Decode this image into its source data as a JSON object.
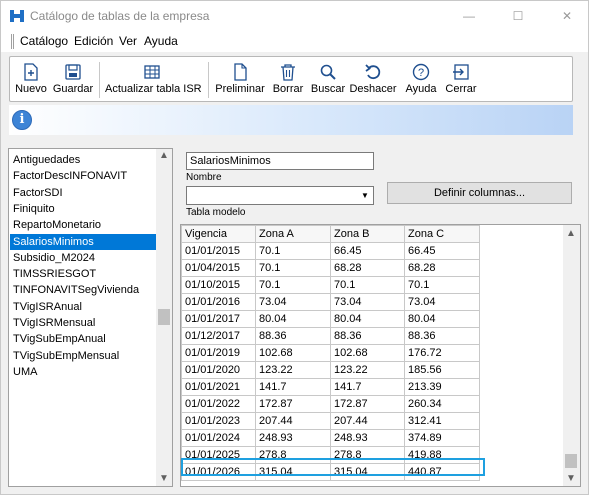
{
  "window": {
    "title": "Catálogo de tablas de la empresa",
    "accent": "#0078d7",
    "highlight_color": "#1ea0e0"
  },
  "menu": [
    "Catálogo",
    "Edición",
    "Ver",
    "Ayuda"
  ],
  "toolbar": {
    "group1": [
      {
        "label": "Nuevo",
        "icon": "new-file-icon"
      },
      {
        "label": "Guardar",
        "icon": "save-icon"
      }
    ],
    "group2": [
      {
        "label": "Actualizar tabla ISR",
        "icon": "table-grid-icon"
      }
    ],
    "group3": [
      {
        "label": "Preliminar",
        "icon": "preview-page-icon"
      },
      {
        "label": "Borrar",
        "icon": "trash-icon"
      },
      {
        "label": "Buscar",
        "icon": "search-icon"
      },
      {
        "label": "Deshacer",
        "icon": "undo-icon"
      },
      {
        "label": "Ayuda",
        "icon": "help-icon"
      },
      {
        "label": "Cerrar",
        "icon": "exit-icon"
      }
    ]
  },
  "table_list": {
    "items": [
      "Antiguedades",
      "FactorDescINFONAVIT",
      "FactorSDI",
      "Finiquito",
      "RepartoMonetario",
      "SalariosMinimos",
      "Subsidio_M2024",
      "TIMSSRIESGOT",
      "TINFONAVITSegVivienda",
      "TVigISRAnual",
      "TVigISRMensual",
      "TVigSubEmpAnual",
      "TVigSubEmpMensual",
      "UMA"
    ],
    "selected_index": 5
  },
  "form": {
    "name_value": "SalariosMinimos",
    "name_caption": "Nombre",
    "model_caption": "Tabla modelo",
    "model_value": "",
    "define_columns_label": "Definir columnas..."
  },
  "grid": {
    "columns": [
      "Vigencia",
      "Zona A",
      "Zona B",
      "Zona C"
    ],
    "rows": [
      [
        "01/01/2015",
        "70.1",
        "66.45",
        "66.45"
      ],
      [
        "01/04/2015",
        "70.1",
        "68.28",
        "68.28"
      ],
      [
        "01/10/2015",
        "70.1",
        "70.1",
        "70.1"
      ],
      [
        "01/01/2016",
        "73.04",
        "73.04",
        "73.04"
      ],
      [
        "01/01/2017",
        "80.04",
        "80.04",
        "80.04"
      ],
      [
        "01/12/2017",
        "88.36",
        "88.36",
        "88.36"
      ],
      [
        "01/01/2019",
        "102.68",
        "102.68",
        "176.72"
      ],
      [
        "01/01/2020",
        "123.22",
        "123.22",
        "185.56"
      ],
      [
        "01/01/2021",
        "141.7",
        "141.7",
        "213.39"
      ],
      [
        "01/01/2022",
        "172.87",
        "172.87",
        "260.34"
      ],
      [
        "01/01/2023",
        "207.44",
        "207.44",
        "312.41"
      ],
      [
        "01/01/2024",
        "248.93",
        "248.93",
        "374.89"
      ],
      [
        "01/01/2025",
        "278.8",
        "278.8",
        "419.88"
      ],
      [
        "01/01/2026",
        "315.04",
        "315.04",
        "440.87"
      ]
    ],
    "highlighted_row": 13
  }
}
